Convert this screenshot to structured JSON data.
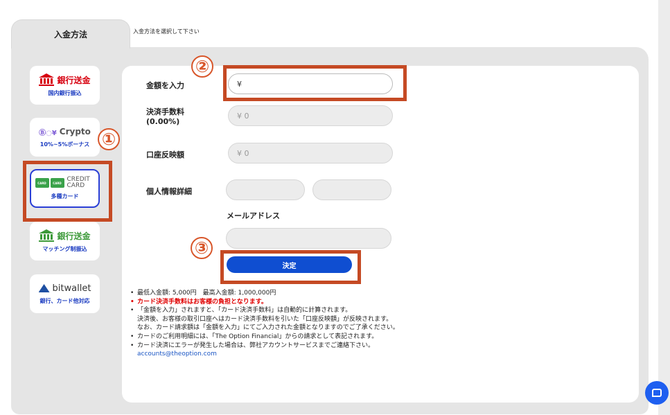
{
  "tabs": {
    "active_label": "入金方法",
    "hint": "入金方法を選択して下さい"
  },
  "methods": [
    {
      "title": "銀行送金",
      "sub": "国内銀行振込",
      "icon": "bank-icon"
    },
    {
      "title": "Crypto",
      "sub": "10%~5%ボーナス",
      "icon": "crypto-icon"
    },
    {
      "title": "CREDIT CARD",
      "sub": "多種カード",
      "icon": "credit-card-icon"
    },
    {
      "title": "銀行送金",
      "sub": "マッチング制振込",
      "icon": "bank-icon"
    },
    {
      "title": "bitwallet",
      "sub": "銀行、カード他対応",
      "icon": "bitwallet-icon"
    }
  ],
  "form": {
    "amount_label": "金額を入力",
    "amount_prefix": "¥",
    "fee_label": "決済手数料",
    "fee_rate": "(0.00%)",
    "fee_value": "¥  0",
    "reflect_label": "口座反映額",
    "reflect_value": "¥  0",
    "personal_label": "個人情報詳細",
    "email_label": "メールアドレス",
    "submit_label": "決定"
  },
  "annotations": [
    "①",
    "②",
    "③"
  ],
  "notes": {
    "line1": "最低入金額: 5,000円　最高入金額: 1,000,000円",
    "line2": "カード決済手数料はお客様の負担となります。",
    "line3": "「金額を入力」されますと、「カード決済手数料」は自動的に計算されます。",
    "line3b": "決済後、お客様の取引口座へはカード決済手数料を引いた「口座反映額」が反映されます。",
    "line3c": "なお、カード請求額は「金額を入力」にてご入力された金額となりますのでご了承ください。",
    "line4": "カードのご利用明細には、「The Option Financial」からの請求として表記されます。",
    "line5": "カード決済にエラーが発生した場合は、弊社アカウントサービスまでご連絡下さい。",
    "email": "accounts@theoption.com"
  },
  "colors": {
    "accent": "#0f4ed1",
    "annotation": "#c54a24",
    "warning": "#e00000",
    "bank": "#d7000f",
    "matching": "#3d9a3a"
  }
}
